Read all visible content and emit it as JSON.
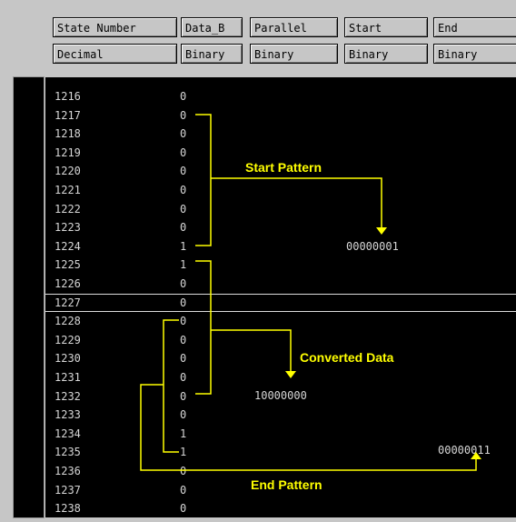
{
  "header": {
    "columns": [
      {
        "label": "State Number",
        "format": "Decimal"
      },
      {
        "label": "Data_B",
        "format": "Binary"
      },
      {
        "label": "Parallel",
        "format": "Binary"
      },
      {
        "label": "Start",
        "format": "Binary"
      },
      {
        "label": "End",
        "format": "Binary"
      }
    ]
  },
  "rows": [
    {
      "state": "1216",
      "data": "0"
    },
    {
      "state": "1217",
      "data": "0"
    },
    {
      "state": "1218",
      "data": "0"
    },
    {
      "state": "1219",
      "data": "0"
    },
    {
      "state": "1220",
      "data": "0"
    },
    {
      "state": "1221",
      "data": "0"
    },
    {
      "state": "1222",
      "data": "0"
    },
    {
      "state": "1223",
      "data": "0"
    },
    {
      "state": "1224",
      "data": "1"
    },
    {
      "state": "1225",
      "data": "1"
    },
    {
      "state": "1226",
      "data": "0"
    },
    {
      "state": "1227",
      "data": "0"
    },
    {
      "state": "1228",
      "data": "0"
    },
    {
      "state": "1229",
      "data": "0"
    },
    {
      "state": "1230",
      "data": "0"
    },
    {
      "state": "1231",
      "data": "0"
    },
    {
      "state": "1232",
      "data": "0"
    },
    {
      "state": "1233",
      "data": "0"
    },
    {
      "state": "1234",
      "data": "1"
    },
    {
      "state": "1235",
      "data": "1"
    },
    {
      "state": "1236",
      "data": "0"
    },
    {
      "state": "1237",
      "data": "0"
    },
    {
      "state": "1238",
      "data": "0"
    }
  ],
  "selected_state": "1227",
  "annotations": {
    "start_pattern_label": "Start Pattern",
    "start_value": "00000001",
    "converted_label": "Converted Data",
    "converted_value": "10000000",
    "end_pattern_label": "End Pattern",
    "end_value": "00000011"
  },
  "colors": {
    "annotation": "#ffff00",
    "listing_bg": "#000000",
    "listing_text": "#d6d6d6",
    "chrome": "#c6c6c6"
  }
}
